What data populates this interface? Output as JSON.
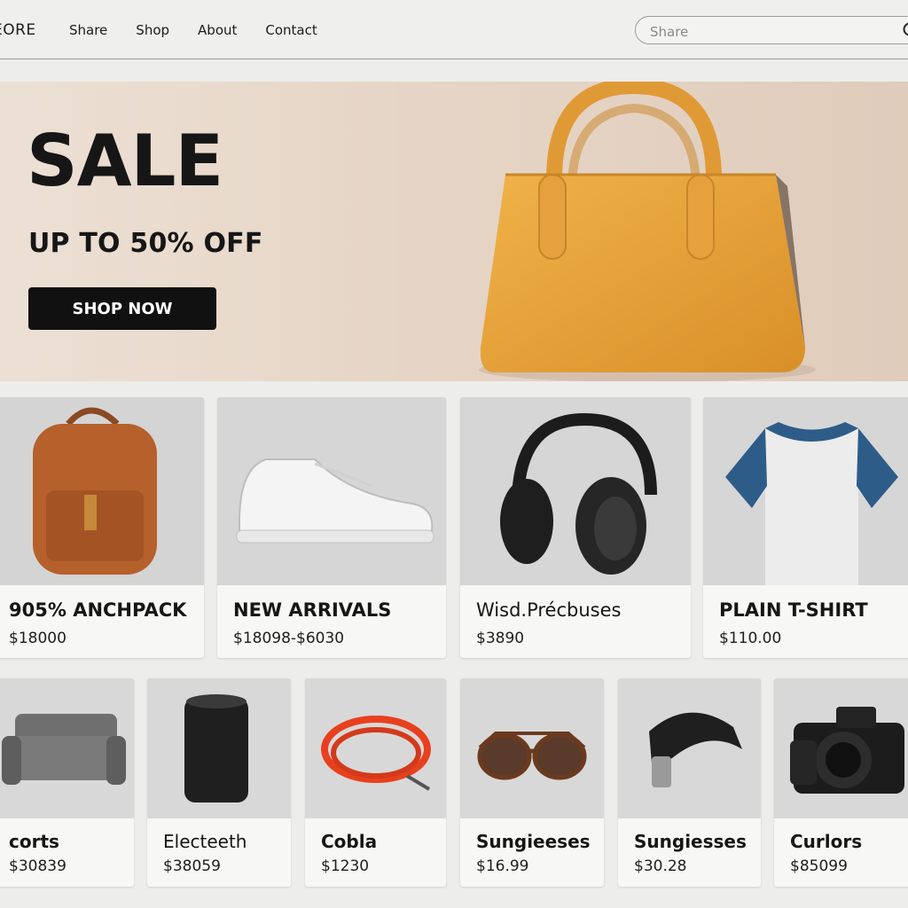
{
  "header": {
    "logo": "EORE",
    "nav": [
      "Share",
      "Shop",
      "About",
      "Contact"
    ],
    "search_placeholder": "Share"
  },
  "hero": {
    "title": "SALE",
    "subtitle": "UP TO 50% OFF",
    "cta": "SHOP NOW",
    "accent": "#e8a33a"
  },
  "products_row1": [
    {
      "name": "905% ANCHPACK",
      "price": "$18000",
      "icon": "backpack-icon"
    },
    {
      "name": "NEW ARRIVALS",
      "price": "$18098-$6030",
      "icon": "sneaker-icon"
    },
    {
      "name": "Wisd.Précbuses",
      "price": "$3890",
      "icon": "headphones-icon"
    },
    {
      "name": "PLAIN T-SHIRT",
      "price": "$110.00",
      "icon": "tshirt-icon"
    }
  ],
  "products_row2": [
    {
      "name": "corts",
      "price": "$30839",
      "icon": "sofa-icon"
    },
    {
      "name": "Electeeth",
      "price": "$38059",
      "icon": "speaker-icon"
    },
    {
      "name": "Cobla",
      "price": "$1230",
      "icon": "cable-icon"
    },
    {
      "name": "Sungieeses",
      "price": "$16.99",
      "icon": "sunglasses-icon"
    },
    {
      "name": "Sungiesses",
      "price": "$30.28",
      "icon": "watch-icon"
    },
    {
      "name": "Curlors",
      "price": "$85099",
      "icon": "camera-icon"
    }
  ]
}
